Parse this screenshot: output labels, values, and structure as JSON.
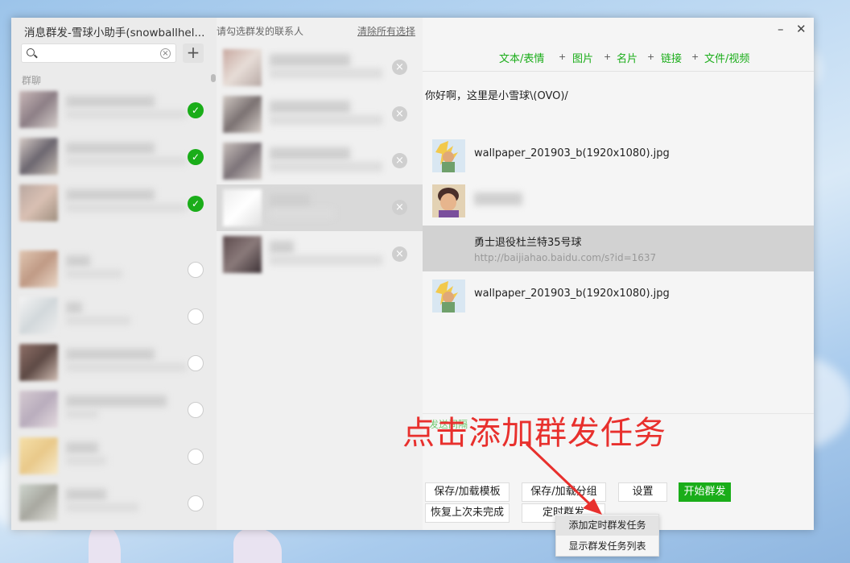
{
  "window": {
    "title": "消息群发-雪球小助手(snowballhel...",
    "minimize": "–",
    "close": "✕"
  },
  "left_panel": {
    "search_placeholder": "",
    "search_clear": "×",
    "add_label": "+",
    "section_label": "群聊",
    "check_mark": "✓",
    "rows": [
      {
        "checked": true
      },
      {
        "checked": true
      },
      {
        "checked": true
      },
      {
        "checked": false
      },
      {
        "checked": false
      },
      {
        "checked": false
      },
      {
        "checked": false
      },
      {
        "checked": false
      },
      {
        "checked": false
      }
    ]
  },
  "middle_panel": {
    "title": "请勾选群发的联系人",
    "clear_all": "清除所有选择",
    "remove_mark": "×"
  },
  "toolbar": {
    "text_emoji": "文本/表情",
    "image": "图片",
    "card": "名片",
    "link": "链接",
    "file_video": "文件/视频",
    "plus": "+"
  },
  "messages": {
    "text": "你好啊，这里是小雪球\\(OVO)/",
    "file1": "wallpaper_201903_b(1920x1080).jpg",
    "link_title": "勇士退役杜兰特35号球",
    "link_url": "http://baijiahao.baidu.com/s?id=1637",
    "file2": "wallpaper_201903_b(1920x1080).jpg",
    "ghost": "发送间隔"
  },
  "buttons": {
    "save_template": "保存/加载模板",
    "save_group": "保存/加载分组",
    "settings": "设置",
    "start": "开始群发",
    "restore": "恢复上次未完成",
    "scheduled": "定时群发"
  },
  "context_menu": {
    "add_task": "添加定时群发任务",
    "show_list": "显示群发任务列表"
  },
  "annotation": {
    "text": "点击添加群发任务",
    "color": "#e8302d"
  },
  "colors": {
    "accent": "#1aad19"
  }
}
